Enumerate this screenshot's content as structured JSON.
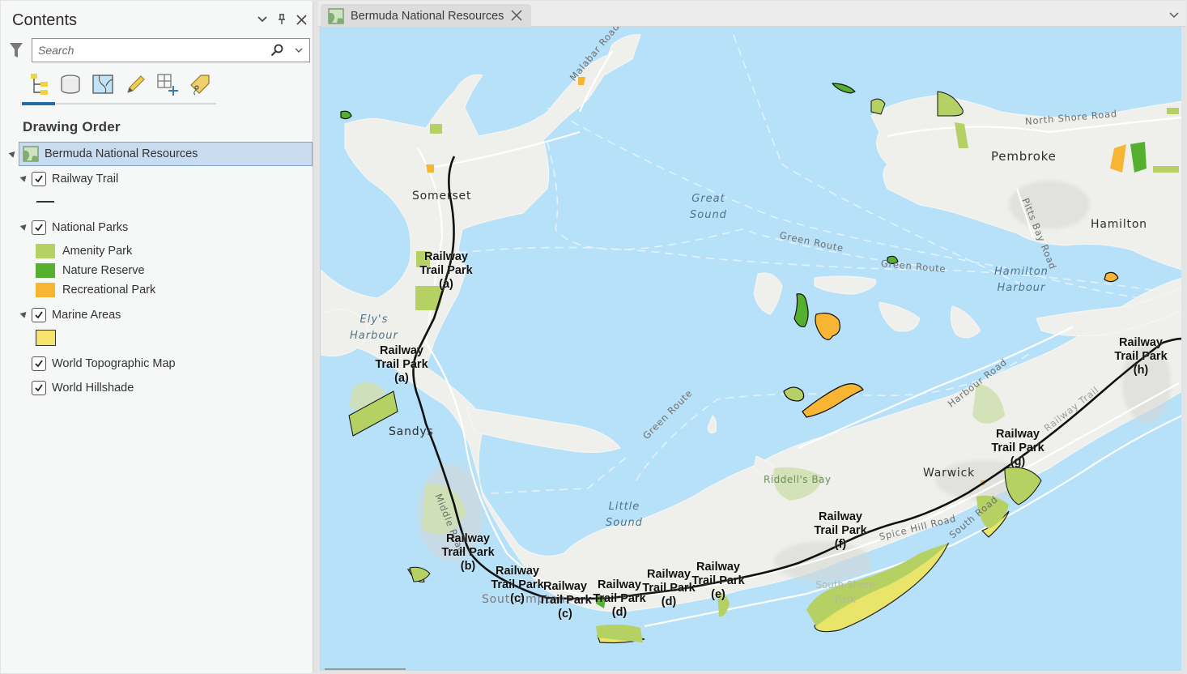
{
  "contents_pane": {
    "title": "Contents",
    "controls": [
      "chevron-down",
      "pin",
      "close"
    ],
    "search": {
      "placeholder": "Search",
      "value": ""
    },
    "toolbar": [
      {
        "name": "list-by-drawing-order",
        "active": true
      },
      {
        "name": "list-by-data-source",
        "active": false
      },
      {
        "name": "list-by-selection",
        "active": false
      },
      {
        "name": "list-by-editing",
        "active": false
      },
      {
        "name": "list-by-snapping",
        "active": false
      },
      {
        "name": "list-by-labeling",
        "active": false
      }
    ],
    "section_title": "Drawing Order",
    "map_name": "Bermuda National Resources",
    "layers": {
      "railway_trail": {
        "label": "Railway Trail",
        "checked": true,
        "symbol_color": "#333333"
      },
      "national_parks": {
        "label": "National Parks",
        "checked": true,
        "classes": [
          {
            "label": "Amenity Park",
            "color": "#b5d063"
          },
          {
            "label": "Nature Reserve",
            "color": "#55b030"
          },
          {
            "label": "Recreational Park",
            "color": "#f8b533"
          }
        ]
      },
      "marine_areas": {
        "label": "Marine Areas",
        "checked": true,
        "color": "#f6e36b",
        "outline": "#333333"
      },
      "world_topographic_map": {
        "label": "World Topographic Map",
        "checked": true
      },
      "world_hillshade": {
        "label": "World Hillshade",
        "checked": true
      }
    }
  },
  "map_view": {
    "tab_label": "Bermuda National Resources",
    "colors": {
      "water": "#b7e1f8",
      "land": "#efefec",
      "land_shade": "#dcdcd8",
      "road": "#ffffff",
      "ferry_route": "#e6f3fb",
      "amenity": "#b5d063",
      "nature": "#55b030",
      "recreational": "#f8b533",
      "marine": "#e9e46a",
      "trail": "#111111",
      "park_base": "#cfe0b4"
    },
    "water_labels": [
      {
        "id": "great-sound",
        "lines": [
          "Great",
          "Sound"
        ]
      },
      {
        "id": "hamilton-harbour",
        "lines": [
          "Hamilton",
          "Harbour"
        ]
      },
      {
        "id": "elys-harbour",
        "lines": [
          "Ely's",
          "Harbour"
        ]
      },
      {
        "id": "little-sound",
        "lines": [
          "Little",
          "Sound"
        ]
      }
    ],
    "place_labels": [
      "Somerset",
      "Sandys",
      "Pembroke",
      "Hamilton",
      "Warwick",
      "Southampton"
    ],
    "road_labels": [
      "Malabar Road",
      "North Shore Road",
      "Pitts Bay Road",
      "Green Route",
      "Green Route",
      "Green Route",
      "Harbour Road",
      "Spice Hill Road",
      "South Road",
      "Middle Road",
      "Railway Trail"
    ],
    "park_labels": [
      "Riddell's Bay",
      "South Shore Park"
    ],
    "trail_labels": [
      "Railway Trail Park (a)",
      "Railway Trail Park (a)",
      "Railway Trail Park (b)",
      "Railway Trail Park (c)",
      "Railway Trail Park (c)",
      "Railway Trail Park (d)",
      "Railway Trail Park (d)",
      "Railway Trail Park (e)",
      "Railway Trail Park (f)",
      "Railway Trail Park (g)",
      "Railway Trail Park (h)"
    ]
  }
}
